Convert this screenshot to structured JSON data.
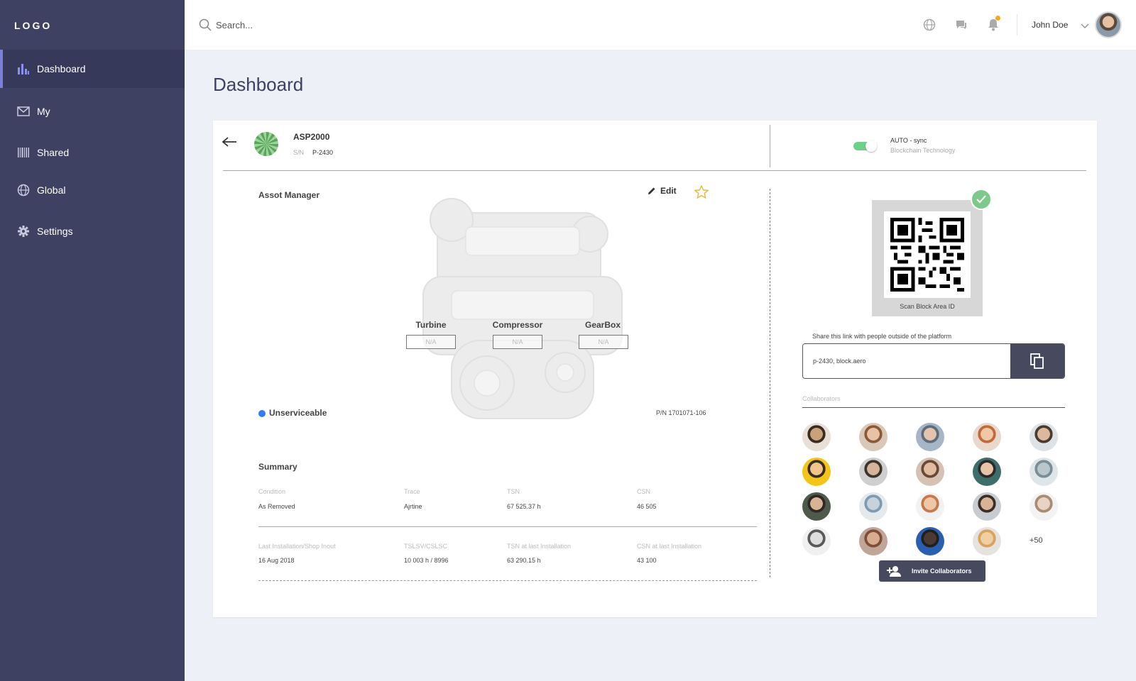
{
  "sidebar": {
    "logo": "LOGO",
    "items": [
      {
        "label": "Dashboard",
        "icon": "bar-chart-icon"
      },
      {
        "label": "My",
        "icon": "mail-icon"
      },
      {
        "label": "Shared",
        "icon": "barcode-icon"
      },
      {
        "label": "Global",
        "icon": "globe-icon"
      },
      {
        "label": "Settings",
        "icon": "gear-icon"
      }
    ],
    "active": "Dashboard",
    "accent_color": "#7b7fdc"
  },
  "header": {
    "search_placeholder": "Search...",
    "icons": [
      "globe-icon",
      "chat-icon",
      "bell-icon"
    ],
    "user_name": "John Doe"
  },
  "page_title": "Dashboard",
  "asset": {
    "name": "ASP2000",
    "sn_label": "S/N",
    "sn_value": "P-2430",
    "sync_title": "AUTO - sync",
    "sync_subtitle": "Blockchain Technology",
    "sync_enabled": true
  },
  "manager": {
    "title": "Assot Manager",
    "edit_label": "Edit",
    "components": [
      {
        "name": "Turbine",
        "value": "N/A"
      },
      {
        "name": "Compressor",
        "value": "N/A"
      },
      {
        "name": "GearBox",
        "value": "N/A"
      }
    ],
    "status": "Unserviceable",
    "status_color": "#2f7cf6",
    "part_number": "P/N 1701071-106"
  },
  "summary": {
    "title": "Summary",
    "rows": [
      [
        {
          "label": "Condition",
          "value": "As Removed"
        },
        {
          "label": "Trace",
          "value": "Ajrtine"
        },
        {
          "label": "TSN",
          "value": "67 525.37 h"
        },
        {
          "label": "CSN",
          "value": "46 505"
        }
      ],
      [
        {
          "label": "Last Installation/Shop Inout",
          "value": "16 Aug 2018"
        },
        {
          "label": "TSLSV/CSLSC",
          "value": "10 003 h / 8996"
        },
        {
          "label": "TSN at last Installation",
          "value": "63 290.15 h"
        },
        {
          "label": "CSN at last Installation",
          "value": "43 100"
        }
      ]
    ]
  },
  "qr": {
    "caption": "Scan Block Area ID"
  },
  "share": {
    "label": "Share this link with people outside of the platform",
    "link_value": "p-2430, block.aero"
  },
  "collaborators": {
    "label": "Collaborators",
    "more": "+50",
    "invite_label": "Invite Collaborators",
    "count_shown": 19
  }
}
